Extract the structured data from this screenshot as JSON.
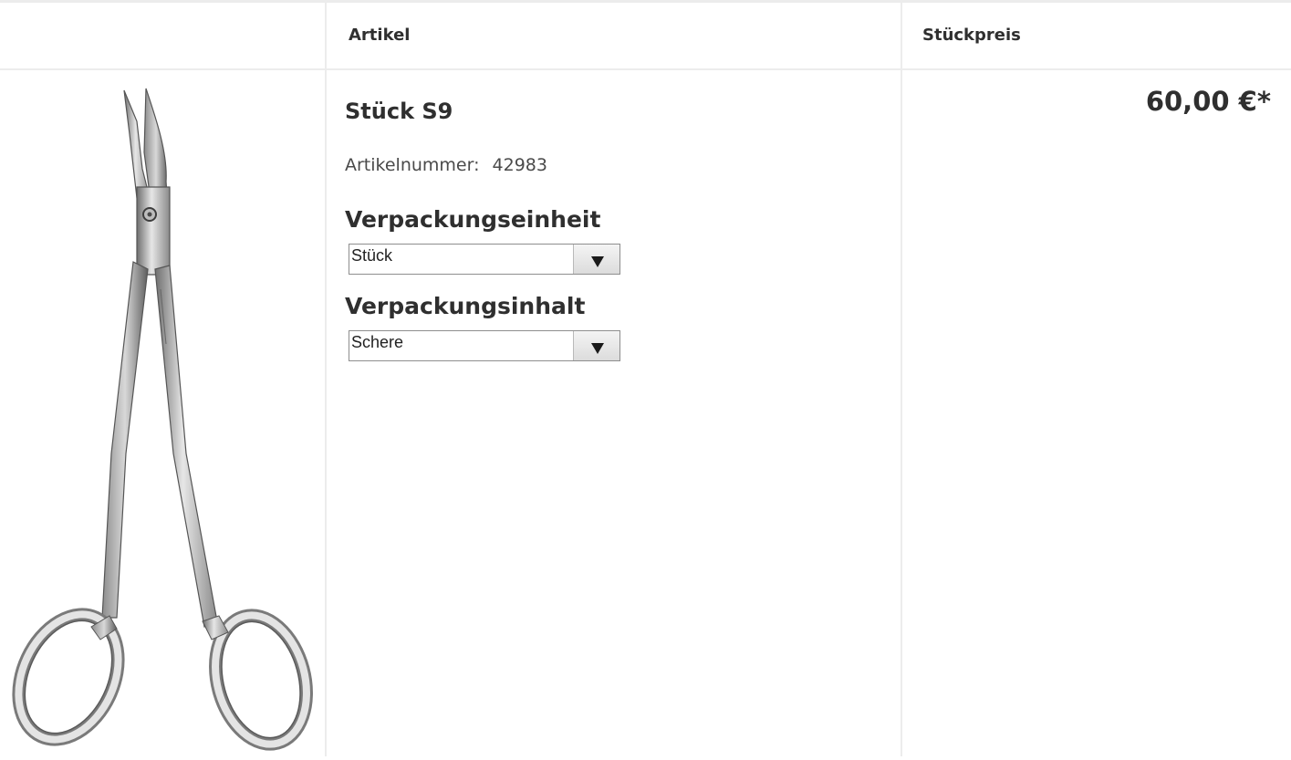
{
  "table": {
    "headers": {
      "image": "",
      "article": "Artikel",
      "unit_price": "Stückpreis"
    }
  },
  "product": {
    "image_icon": "surgical-scissors-image",
    "name": "Stück S9",
    "sku_label": "Artikelnummer:",
    "sku_value": "42983",
    "price": "60,00 €*",
    "options": [
      {
        "label": "Verpackungseinheit",
        "selected": "Stück"
      },
      {
        "label": "Verpackungsinhalt",
        "selected": "Schere"
      }
    ]
  }
}
